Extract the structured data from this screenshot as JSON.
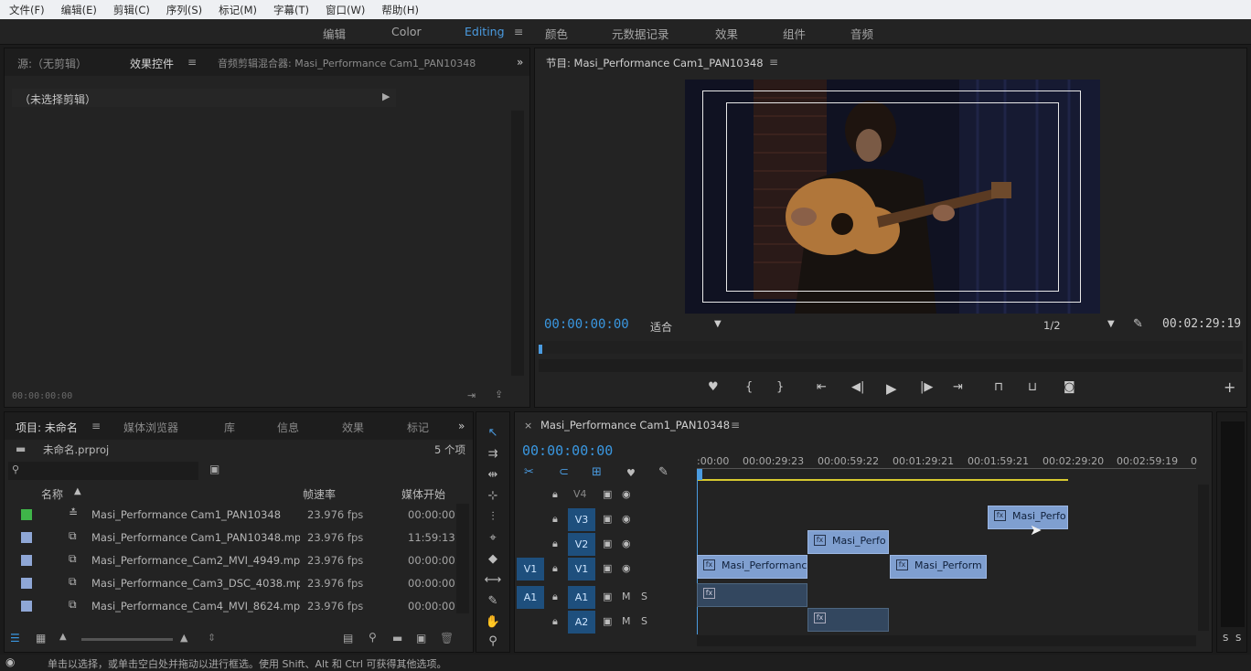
{
  "menubar": [
    "文件(F)",
    "编辑(E)",
    "剪辑(C)",
    "序列(S)",
    "标记(M)",
    "字幕(T)",
    "窗口(W)",
    "帮助(H)"
  ],
  "workspaces": {
    "items": [
      "编辑",
      "Color",
      "Editing",
      "颜色",
      "元数据记录",
      "效果",
      "组件",
      "音频"
    ],
    "active": "Editing",
    "menu_icon": "≡"
  },
  "source_panel": {
    "tabs": [
      "源:（无剪辑）",
      "效果控件",
      "音频剪辑混合器: Masi_Performance Cam1_PAN10348"
    ],
    "active_tab": "效果控件",
    "overflow": "»",
    "no_clip_text": "（未选择剪辑）",
    "timecode": "00:00:00:00"
  },
  "program_monitor": {
    "title": "节目: Masi_Performance Cam1_PAN10348",
    "timecode": "00:00:00:00",
    "fit": "适合",
    "resolution": "1/2",
    "duration": "00:02:29:19",
    "controls": [
      "marker-icon",
      "mark-in-icon",
      "mark-out-icon",
      "go-to-in-icon",
      "step-back-icon",
      "play-icon",
      "step-forward-icon",
      "go-to-out-icon",
      "lift-icon",
      "extract-icon",
      "export-frame-icon",
      "add-button-icon"
    ]
  },
  "project_panel": {
    "tabs": [
      "项目: 未命名",
      "媒体浏览器",
      "库",
      "信息",
      "效果",
      "标记"
    ],
    "active_tab": "项目: 未命名",
    "file": "未命名.prproj",
    "count": "5 个项",
    "columns": [
      "名称",
      "帧速率",
      "媒体开始"
    ],
    "items": [
      {
        "name": "Masi_Performance Cam1_PAN10348",
        "fps": "23.976 fps",
        "start": "00:00:00:",
        "color": "#3fb549",
        "type": "sequence"
      },
      {
        "name": "Masi_Performance Cam1_PAN10348.mp4",
        "fps": "23.976 fps",
        "start": "11:59:13:",
        "color": "#8fa7d6",
        "type": "video"
      },
      {
        "name": "Masi_Performance_Cam2_MVI_4949.mp",
        "fps": "23.976 fps",
        "start": "00:00:00:",
        "color": "#8fa7d6",
        "type": "video"
      },
      {
        "name": "Masi_Performance_Cam3_DSC_4038.mp",
        "fps": "23.976 fps",
        "start": "00:00:00:",
        "color": "#8fa7d6",
        "type": "video"
      },
      {
        "name": "Masi_Performance_Cam4_MVI_8624.mp",
        "fps": "23.976 fps",
        "start": "00:00:00:",
        "color": "#8fa7d6",
        "type": "video"
      }
    ]
  },
  "timeline": {
    "title": "Masi_Performance Cam1_PAN10348",
    "timecode": "00:00:00:00",
    "ruler": [
      ":00:00",
      "00:00:29:23",
      "00:00:59:22",
      "00:01:29:21",
      "00:01:59:21",
      "00:02:29:20",
      "00:02:59:19",
      "0"
    ],
    "tracks": [
      {
        "id": "V4",
        "src": ""
      },
      {
        "id": "V3",
        "src": ""
      },
      {
        "id": "V2",
        "src": ""
      },
      {
        "id": "V1",
        "src": "V1"
      },
      {
        "id": "A1",
        "src": "A1"
      },
      {
        "id": "A2",
        "src": ""
      }
    ],
    "clips": [
      "Masi_Perfo",
      "Masi_Perfo",
      "Masi_Performanc",
      "Masi_Perform"
    ],
    "meter_labels": [
      "S",
      "S"
    ]
  },
  "status_bar": "单击以选择，或单击空白处并拖动以进行框选。使用 Shift、Alt 和 Ctrl 可获得其他选项。"
}
